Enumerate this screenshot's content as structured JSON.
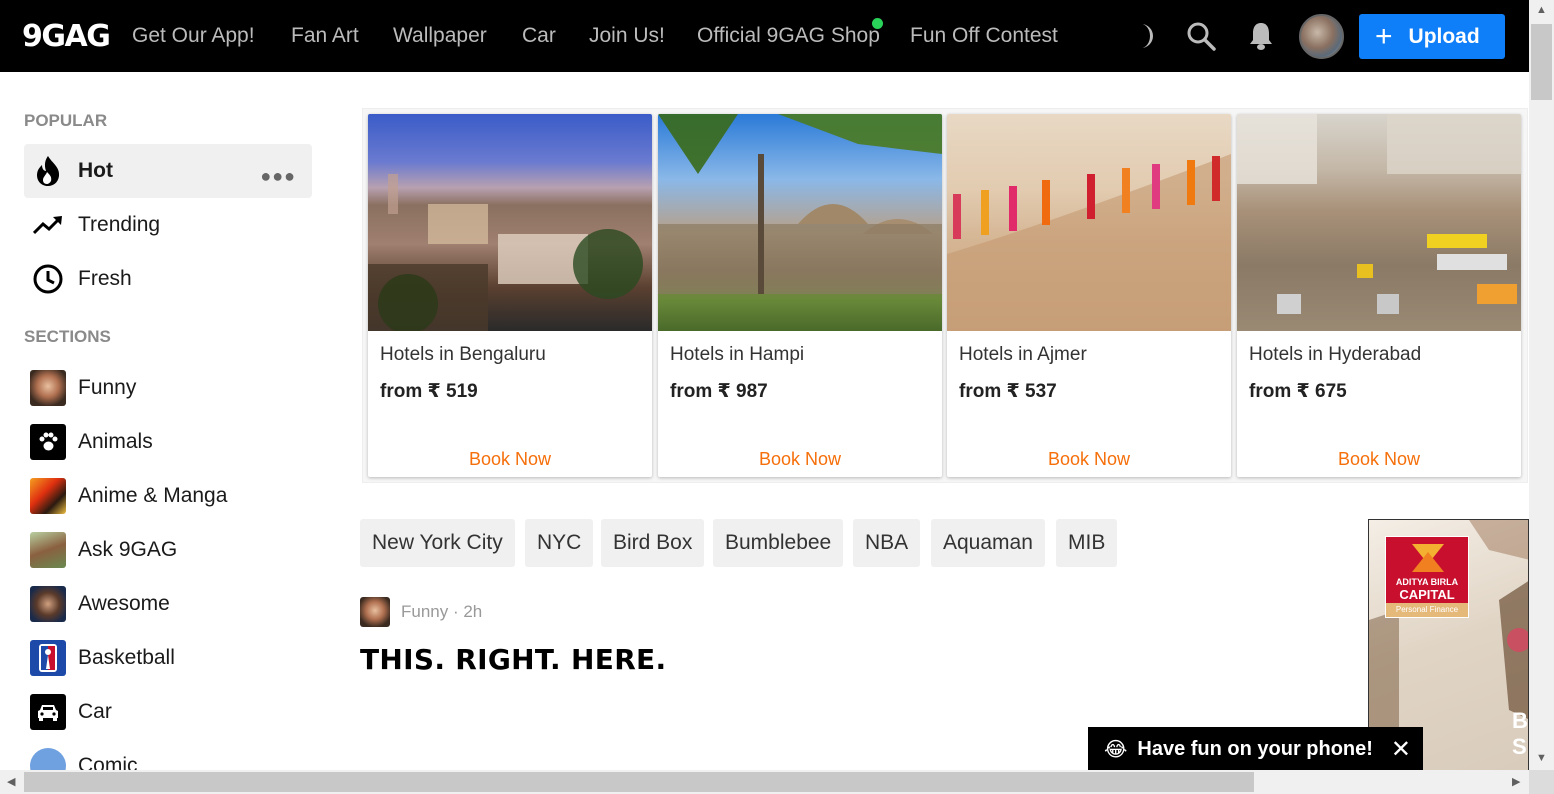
{
  "nav": {
    "logo": "9GAG",
    "links": [
      "Get Our App!",
      "Fan Art",
      "Wallpaper",
      "Car",
      "Join Us!",
      "Official 9GAG Shop",
      "Fun Off Contest"
    ],
    "upload_label": "Upload",
    "icons": [
      "moon-icon",
      "search-icon",
      "bell-icon",
      "avatar"
    ]
  },
  "sidebar": {
    "popular_heading": "POPULAR",
    "popular": [
      {
        "label": "Hot",
        "icon": "fire-icon",
        "active": true
      },
      {
        "label": "Trending",
        "icon": "trending-icon"
      },
      {
        "label": "Fresh",
        "icon": "clock-icon"
      }
    ],
    "sections_heading": "SECTIONS",
    "sections": [
      {
        "label": "Funny"
      },
      {
        "label": "Animals"
      },
      {
        "label": "Anime & Manga"
      },
      {
        "label": "Ask 9GAG"
      },
      {
        "label": "Awesome"
      },
      {
        "label": "Basketball"
      },
      {
        "label": "Car"
      },
      {
        "label": "Comic"
      }
    ]
  },
  "hotels": [
    {
      "name": "Hotels in Bengaluru",
      "price": "from ₹ 519",
      "cta": "Book Now"
    },
    {
      "name": "Hotels in Hampi",
      "price": "from ₹ 987",
      "cta": "Book Now"
    },
    {
      "name": "Hotels in Ajmer",
      "price": "from ₹ 537",
      "cta": "Book Now"
    },
    {
      "name": "Hotels in Hyderabad",
      "price": "from ₹ 675",
      "cta": "Book Now"
    }
  ],
  "tags": [
    "New York City",
    "NYC",
    "Bird Box",
    "Bumblebee",
    "NBA",
    "Aquaman",
    "MIB"
  ],
  "post": {
    "meta": "Funny · 2h",
    "title": "THIS. RIGHT. HERE."
  },
  "side_ad": {
    "brand_line1": "ADITYA BIRLA",
    "brand_line2": "CAPITAL",
    "brand_sub": "Personal Finance",
    "edge_text": "B\nS"
  },
  "toast": {
    "emoji": "😂",
    "message": "Have fun on your phone!",
    "close": "✕"
  },
  "colors": {
    "nav_bg": "#000000",
    "upload_blue": "#0f7ff9",
    "book_orange": "#f56f0a",
    "online_dot": "#29d35a"
  }
}
